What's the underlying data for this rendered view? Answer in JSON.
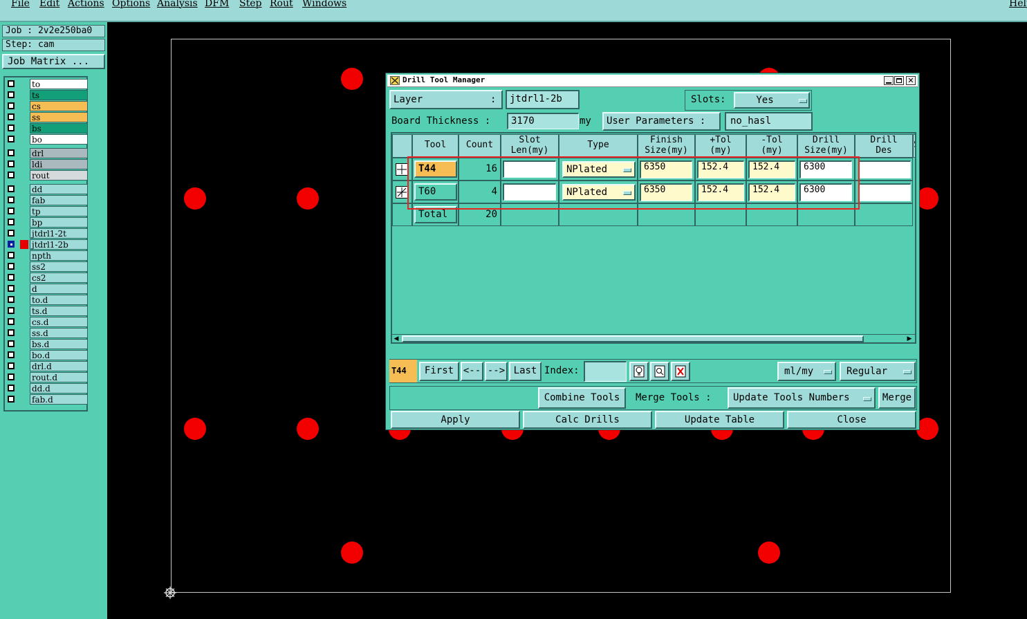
{
  "menu": {
    "items": [
      "File",
      "Edit",
      "Actions",
      "Options",
      "Analysis",
      "DFM",
      "Step",
      "Rout",
      "Windows"
    ],
    "help": "Help"
  },
  "left_panel": {
    "job": "Job : 2v2e250ba0",
    "step": "Step: cam",
    "job_matrix": "Job Matrix ...",
    "layers": [
      {
        "name": "to",
        "color": "#ffffff"
      },
      {
        "name": "ts",
        "color": "#13a079"
      },
      {
        "name": "cs",
        "color": "#f5bd53"
      },
      {
        "name": "ss",
        "color": "#f5bd53"
      },
      {
        "name": "bs",
        "color": "#13a079"
      },
      {
        "name": "bo",
        "color": "#ffffff"
      },
      {
        "name": "drl",
        "color": "#a9b9be"
      },
      {
        "name": "ldi",
        "color": "#a9b9be"
      },
      {
        "name": "rout",
        "color": "#d5dbdc"
      },
      {
        "name": "dd",
        "color": "#9fdcd9"
      },
      {
        "name": "fab",
        "color": "#9fdcd9"
      },
      {
        "name": "tp",
        "color": "#9fdcd9"
      },
      {
        "name": "bp",
        "color": "#9fdcd9"
      },
      {
        "name": "jtdrl1-2t",
        "color": "#9fdcd9"
      },
      {
        "name": "jtdrl1-2b",
        "color": "#9fdcd9",
        "selected": true
      },
      {
        "name": "npth",
        "color": "#9fdcd9"
      },
      {
        "name": "ss2",
        "color": "#9fdcd9"
      },
      {
        "name": "cs2",
        "color": "#9fdcd9"
      },
      {
        "name": "d",
        "color": "#9fdcd9"
      },
      {
        "name": "to.d",
        "color": "#9fdcd9"
      },
      {
        "name": "ts.d",
        "color": "#9fdcd9"
      },
      {
        "name": "cs.d",
        "color": "#9fdcd9"
      },
      {
        "name": "ss.d",
        "color": "#9fdcd9"
      },
      {
        "name": "bs.d",
        "color": "#9fdcd9"
      },
      {
        "name": "bo.d",
        "color": "#9fdcd9"
      },
      {
        "name": "drl.d",
        "color": "#9fdcd9"
      },
      {
        "name": "rout.d",
        "color": "#9fdcd9"
      },
      {
        "name": "dd.d",
        "color": "#9fdcd9"
      },
      {
        "name": "fab.d",
        "color": "#9fdcd9"
      }
    ]
  },
  "dialog": {
    "title": "Drill Tool Manager",
    "layer_label": "Layer",
    "layer_colon": ":",
    "layer_value": "jtdrl1-2b",
    "slots_label": "Slots:",
    "slots_value": "Yes",
    "board_thickness_label": "Board Thickness :",
    "board_thickness_value": "3170",
    "board_thickness_unit": "my",
    "user_params_label": "User Parameters :",
    "user_params_value": "no_hasl",
    "columns": {
      "tool": "Tool",
      "count": "Count",
      "slot1": "Slot",
      "slot2": "Len(my)",
      "type": "Type",
      "finish1": "Finish",
      "finish2": "Size(my)",
      "ptol1": "+Tol",
      "ptol2": "(my)",
      "mtol1": "-Tol",
      "mtol2": "(my)",
      "drill1": "Drill",
      "drill2": "Size(my)",
      "des1": "Drill",
      "des2": "Des",
      "extra": "S"
    },
    "rows": [
      {
        "tool": "T44",
        "count": "16",
        "slot": "",
        "type": "NPlated",
        "finish": "6350",
        "ptol": "152.4",
        "mtol": "152.4",
        "drill": "6300",
        "des": ""
      },
      {
        "tool": "T60",
        "count": "4",
        "slot": "",
        "type": "NPlated",
        "finish": "6350",
        "ptol": "152.4",
        "mtol": "152.4",
        "drill": "6300",
        "des": ""
      }
    ],
    "total_label": "Total",
    "total_count": "20",
    "nav": {
      "current": "T44",
      "first": "First",
      "prev": "<--",
      "next": "-->",
      "last": "Last",
      "index_label": "Index:",
      "index_value": "",
      "units": "ml/my",
      "mode": "Regular"
    },
    "combine_tools": "Combine Tools",
    "merge_tools_label": "Merge Tools :",
    "update_tools_numbers": "Update Tools Numbers",
    "merge": "Merge",
    "apply": "Apply",
    "calc_drills": "Calc Drills",
    "update_table": "Update Table",
    "close": "Close"
  }
}
